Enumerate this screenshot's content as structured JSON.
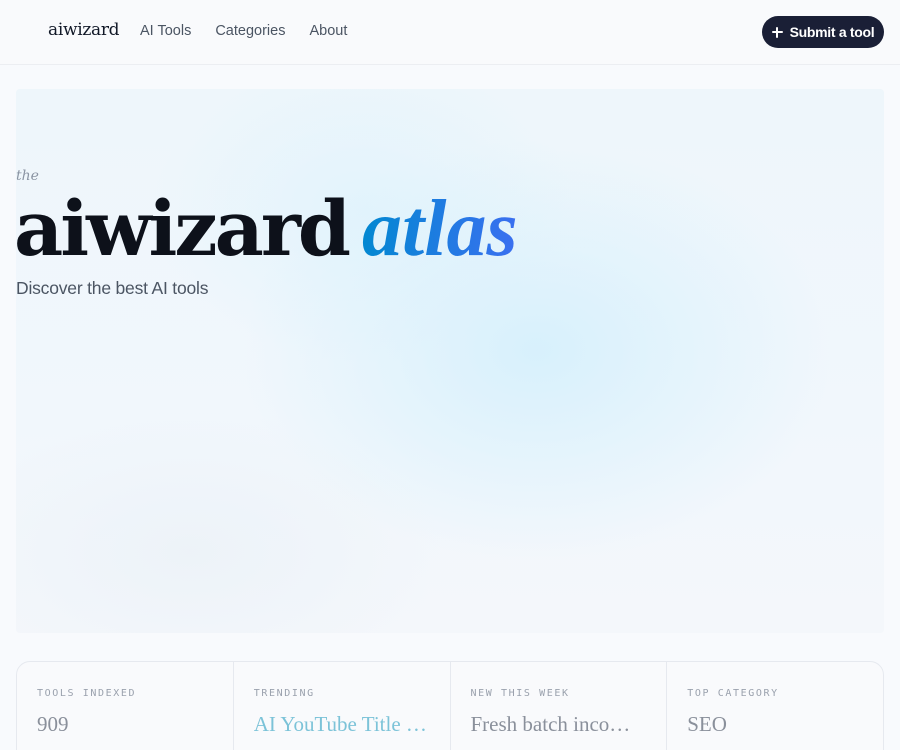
{
  "header": {
    "logo": "aiwizard",
    "nav": [
      "AI Tools",
      "Categories",
      "About"
    ],
    "submit_label": "Submit a tool"
  },
  "hero": {
    "prefix": "the",
    "title_main": "aiwizard",
    "title_accent": "atlas",
    "subtitle": "Discover the best AI tools"
  },
  "stats": [
    {
      "label": "TOOLS INDEXED",
      "value": "909"
    },
    {
      "label": "TRENDING",
      "value": "AI YouTube Title Generator"
    },
    {
      "label": "NEW THIS WEEK",
      "value": "Fresh batch incoming"
    },
    {
      "label": "TOP CATEGORY",
      "value": "SEO"
    }
  ],
  "colors": {
    "primary_button": "#1a1f36",
    "accent_gradient_start": "#0288d1",
    "accent_gradient_end": "#3b6ff0",
    "trending_accent": "#7cc3d8"
  }
}
